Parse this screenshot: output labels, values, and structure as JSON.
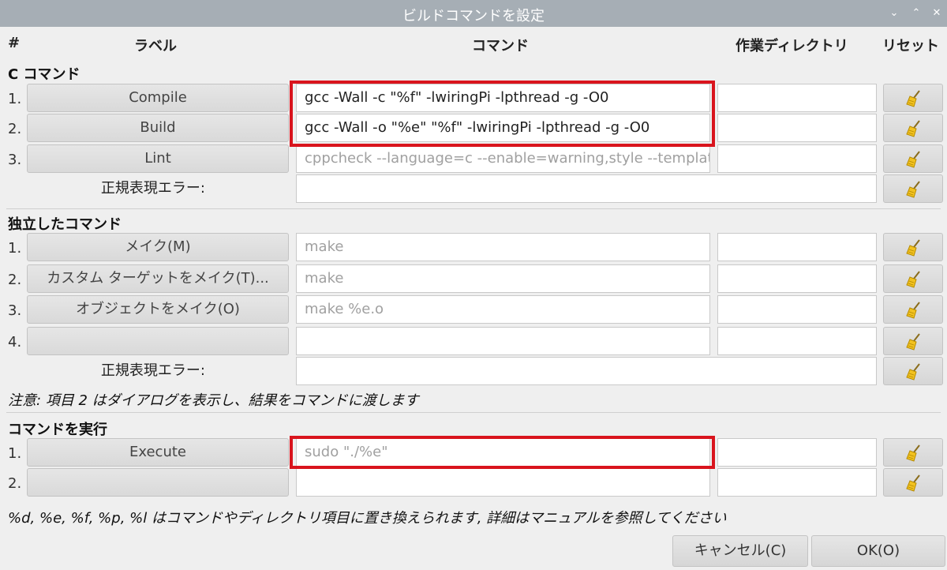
{
  "window": {
    "title": "ビルドコマンドを設定"
  },
  "columns": {
    "num": "#",
    "label": "ラベル",
    "command": "コマンド",
    "dir": "作業ディレクトリ",
    "reset": "リセット"
  },
  "c_commands": {
    "title": "C コマンド",
    "rows": [
      {
        "num": "1.",
        "label": "Compile",
        "command": "gcc -Wall -c \"%f\" -lwiringPi -lpthread -g -O0",
        "dir": ""
      },
      {
        "num": "2.",
        "label": "Build",
        "command": "gcc -Wall -o \"%e\" \"%f\" -lwiringPi -lpthread -g -O0",
        "dir": ""
      },
      {
        "num": "3.",
        "label": "Lint",
        "command": "cppcheck --language=c --enable=warning,style --template=gcc \"%f\"",
        "dir": ""
      }
    ],
    "regex_label": "正規表現エラー:",
    "regex_value": ""
  },
  "independent_commands": {
    "title": "独立したコマンド",
    "rows": [
      {
        "num": "1.",
        "label": "メイク(M)",
        "command": "make",
        "dir": ""
      },
      {
        "num": "2.",
        "label": "カスタム ターゲットをメイク(T)...",
        "command": "make",
        "dir": ""
      },
      {
        "num": "3.",
        "label": "オブジェクトをメイク(O)",
        "command": "make %e.o",
        "dir": ""
      },
      {
        "num": "4.",
        "label": "",
        "command": "",
        "dir": ""
      }
    ],
    "regex_label": "正規表現エラー:",
    "regex_value": ""
  },
  "note1": "注意: 項目 2 はダイアログを表示し、結果をコマンドに渡します",
  "execute_commands": {
    "title": "コマンドを実行",
    "rows": [
      {
        "num": "1.",
        "label": "Execute",
        "command": "sudo \"./%e\"",
        "dir": ""
      },
      {
        "num": "2.",
        "label": "",
        "command": "",
        "dir": ""
      }
    ]
  },
  "note2": "%d, %e, %f, %p, %l はコマンドやディレクトリ項目に置き換えられます, 詳細はマニュアルを参照してください",
  "buttons": {
    "cancel": "キャンセル(C)",
    "ok": "OK(O)"
  },
  "icons": {
    "reset": "broom-icon",
    "minimize": "chevron-down-icon",
    "maximize": "chevron-up-icon",
    "close": "close-icon"
  },
  "colors": {
    "titlebar": "#a6aeb5",
    "highlight": "#d9141d"
  }
}
